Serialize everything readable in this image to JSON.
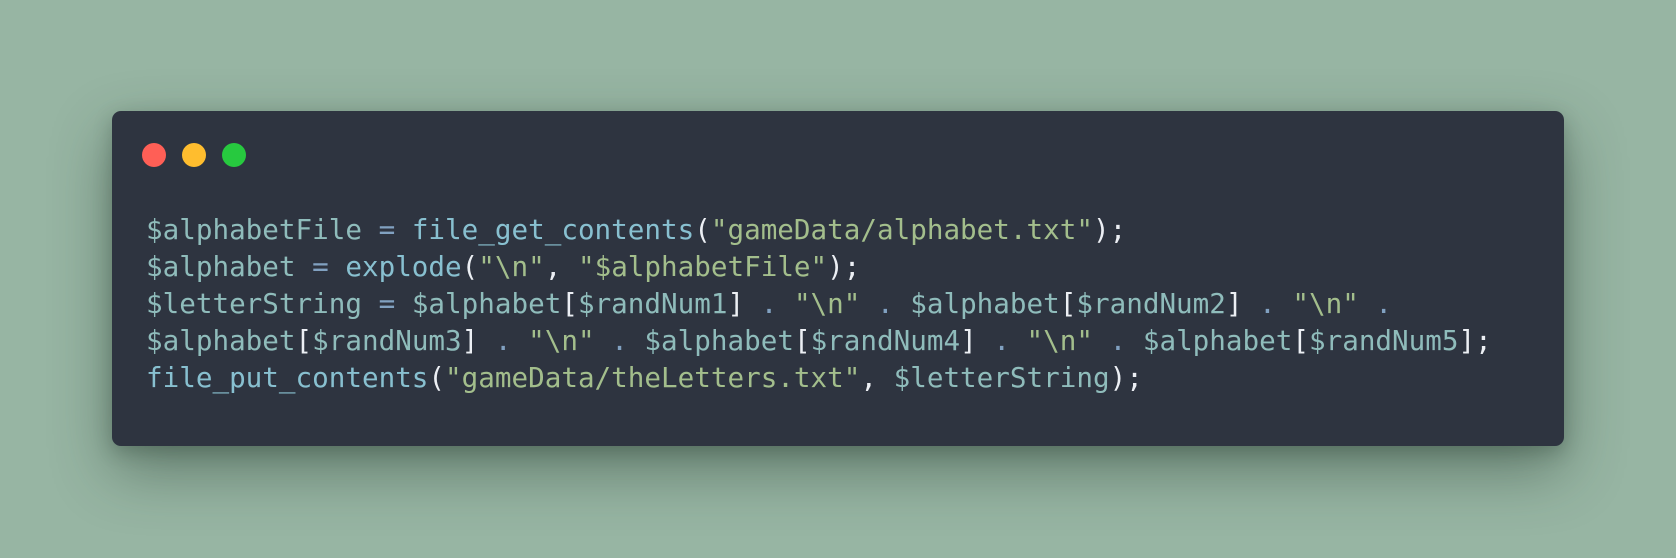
{
  "window": {
    "controls": [
      {
        "name": "close",
        "color": "#ff5f56"
      },
      {
        "name": "minimize",
        "color": "#ffbd2e"
      },
      {
        "name": "maximize",
        "color": "#27c93f"
      }
    ]
  },
  "code": {
    "language": "php",
    "lines": [
      [
        {
          "t": "var",
          "v": "$alphabetFile"
        },
        {
          "t": "op",
          "v": " = "
        },
        {
          "t": "func",
          "v": "file_get_contents"
        },
        {
          "t": "punc",
          "v": "("
        },
        {
          "t": "str",
          "v": "\"gameData/alphabet.txt\""
        },
        {
          "t": "punc",
          "v": ");"
        }
      ],
      [
        {
          "t": "var",
          "v": "$alphabet"
        },
        {
          "t": "op",
          "v": " = "
        },
        {
          "t": "func",
          "v": "explode"
        },
        {
          "t": "punc",
          "v": "("
        },
        {
          "t": "str",
          "v": "\"\\n\""
        },
        {
          "t": "punc",
          "v": ", "
        },
        {
          "t": "str",
          "v": "\"$alphabetFile\""
        },
        {
          "t": "punc",
          "v": ");"
        }
      ],
      [
        {
          "t": "var",
          "v": "$letterString"
        },
        {
          "t": "op",
          "v": " = "
        },
        {
          "t": "var",
          "v": "$alphabet"
        },
        {
          "t": "punc",
          "v": "["
        },
        {
          "t": "var",
          "v": "$randNum1"
        },
        {
          "t": "punc",
          "v": "]"
        },
        {
          "t": "op",
          "v": " . "
        },
        {
          "t": "str",
          "v": "\"\\n\""
        },
        {
          "t": "op",
          "v": " . "
        },
        {
          "t": "var",
          "v": "$alphabet"
        },
        {
          "t": "punc",
          "v": "["
        },
        {
          "t": "var",
          "v": "$randNum2"
        },
        {
          "t": "punc",
          "v": "]"
        },
        {
          "t": "op",
          "v": " . "
        },
        {
          "t": "str",
          "v": "\"\\n\""
        },
        {
          "t": "op",
          "v": " ."
        }
      ],
      [
        {
          "t": "var",
          "v": "$alphabet"
        },
        {
          "t": "punc",
          "v": "["
        },
        {
          "t": "var",
          "v": "$randNum3"
        },
        {
          "t": "punc",
          "v": "]"
        },
        {
          "t": "op",
          "v": " . "
        },
        {
          "t": "str",
          "v": "\"\\n\""
        },
        {
          "t": "op",
          "v": " . "
        },
        {
          "t": "var",
          "v": "$alphabet"
        },
        {
          "t": "punc",
          "v": "["
        },
        {
          "t": "var",
          "v": "$randNum4"
        },
        {
          "t": "punc",
          "v": "]"
        },
        {
          "t": "op",
          "v": " . "
        },
        {
          "t": "str",
          "v": "\"\\n\""
        },
        {
          "t": "op",
          "v": " . "
        },
        {
          "t": "var",
          "v": "$alphabet"
        },
        {
          "t": "punc",
          "v": "["
        },
        {
          "t": "var",
          "v": "$randNum5"
        },
        {
          "t": "punc",
          "v": "];"
        }
      ],
      [
        {
          "t": "func",
          "v": "file_put_contents"
        },
        {
          "t": "punc",
          "v": "("
        },
        {
          "t": "str",
          "v": "\"gameData/theLetters.txt\""
        },
        {
          "t": "punc",
          "v": ", "
        },
        {
          "t": "var",
          "v": "$letterString"
        },
        {
          "t": "punc",
          "v": ");"
        }
      ]
    ]
  }
}
